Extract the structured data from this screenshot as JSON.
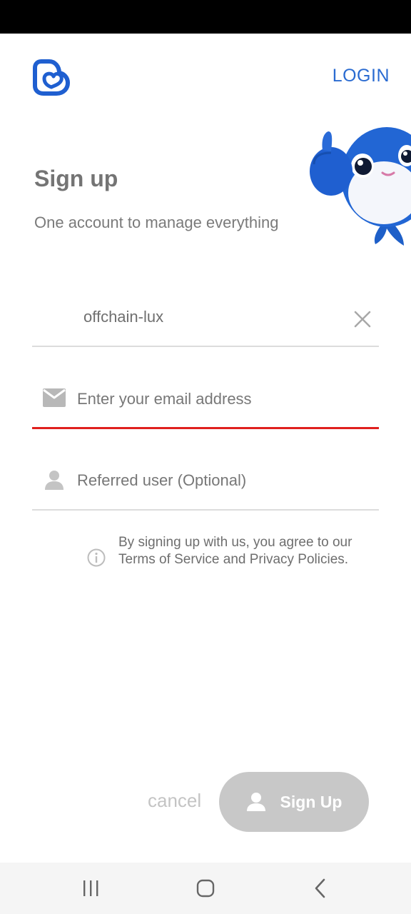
{
  "header": {
    "logo_icon": "brand-heart-logo-icon",
    "login_label": "LOGIN",
    "accent_color": "#2a6bd1"
  },
  "hero": {
    "title": "Sign up",
    "subtitle": "One account to manage everything",
    "mascot": "blue-whale-mascot-thumbs-up"
  },
  "form": {
    "username": {
      "value": "offchain-lux",
      "clear_icon": "close-icon"
    },
    "email": {
      "icon": "envelope-icon",
      "placeholder": "Enter your email address",
      "value": "",
      "error_color": "#e0201e"
    },
    "referral": {
      "icon": "person-icon",
      "placeholder": "Referred user (Optional)",
      "value": ""
    }
  },
  "terms": {
    "icon": "info-icon",
    "text": "By signing up with us, you agree to our Terms of Service and Privacy Policies."
  },
  "actions": {
    "cancel_label": "cancel",
    "signup_label": "Sign Up",
    "signup_icon": "person-icon"
  },
  "system_nav": {
    "recents": "recents-icon",
    "home": "home-icon",
    "back": "back-icon"
  }
}
